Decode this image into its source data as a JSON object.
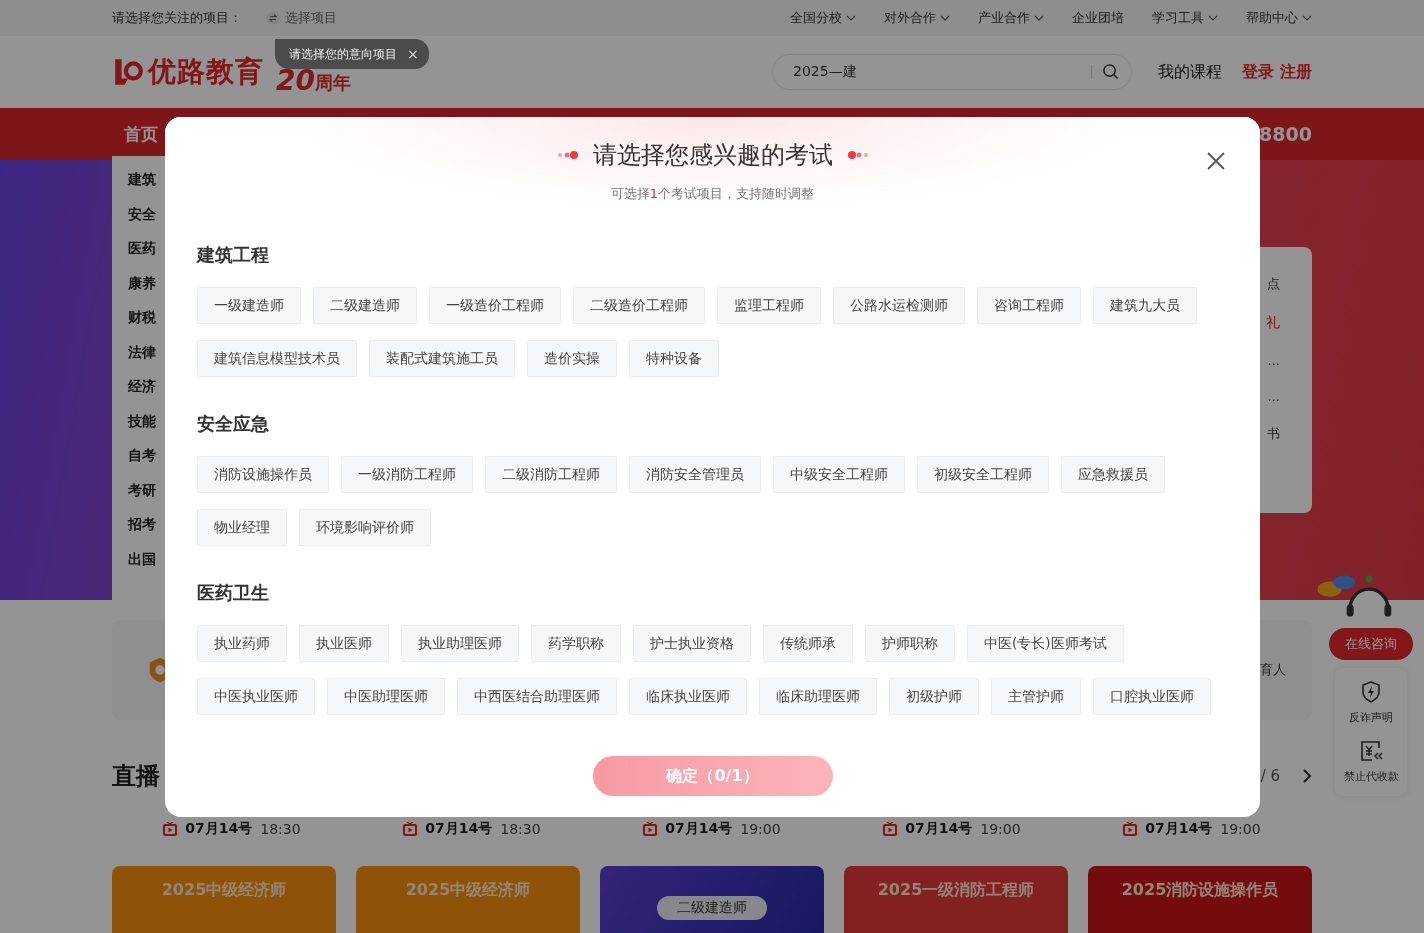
{
  "top_bar": {
    "prompt": "请选择您关注的项目：",
    "select_button": "选择项目",
    "menus": [
      {
        "label": "全国分校",
        "dropdown": true
      },
      {
        "label": "对外合作",
        "dropdown": true
      },
      {
        "label": "产业合作",
        "dropdown": true
      },
      {
        "label": "企业团培",
        "dropdown": false
      },
      {
        "label": "学习工具",
        "dropdown": true
      },
      {
        "label": "帮助中心",
        "dropdown": true
      }
    ]
  },
  "tooltip": {
    "text": "请选择您的意向项目",
    "close": "×"
  },
  "header": {
    "logo": "优路教育",
    "anniversary_number": "20",
    "anniversary_label": "周年",
    "search": {
      "value": "2025—建"
    },
    "my_courses": "我的课程",
    "login": "登录",
    "register": "注册"
  },
  "nav": {
    "items": [
      {
        "label": "首页",
        "selected": true
      }
    ],
    "hotline": "8800"
  },
  "sidebar": {
    "items": [
      "建筑",
      "安全",
      "医药",
      "康养",
      "财税",
      "法律",
      "经济",
      "技能",
      "自考",
      "考研",
      "招考",
      "出国"
    ]
  },
  "promo_panel": {
    "lines": [
      {
        "text": "点",
        "highlight": false
      },
      {
        "text": "礼",
        "highlight": true
      },
      {
        "text": "...",
        "highlight": false
      },
      {
        "text": "...",
        "highlight": false
      },
      {
        "text": "书",
        "highlight": false
      }
    ]
  },
  "feature_row": {
    "text": "育人"
  },
  "live": {
    "title": "直播",
    "page": "/ 6",
    "dates": [
      {
        "date": "07月14号",
        "time": "18:30"
      },
      {
        "date": "07月14号",
        "time": "18:30"
      },
      {
        "date": "07月14号",
        "time": "19:00"
      },
      {
        "date": "07月14号",
        "time": "19:00"
      },
      {
        "date": "07月14号",
        "time": "19:00"
      }
    ],
    "cards": [
      {
        "kind": "banner",
        "title": "2025中级经济师"
      },
      {
        "kind": "banner",
        "title": "2025中级经济师"
      },
      {
        "kind": "pill",
        "title": "二级建造师"
      },
      {
        "kind": "banner",
        "title": "2025一级消防工程师"
      },
      {
        "kind": "banner",
        "title": "2025消防设施操作员"
      }
    ]
  },
  "float": {
    "consult": "在线咨询",
    "links": [
      {
        "label": "反诈声明",
        "kind": "shield"
      },
      {
        "label": "禁止代收款",
        "kind": "yen"
      }
    ]
  },
  "modal": {
    "title": "请选择您感兴趣的考试",
    "subtitle_before": "可选择",
    "subtitle_count": "1",
    "subtitle_after": "个考试项目，支持随时调整",
    "confirm": "确定（0/1）",
    "sections": [
      {
        "title": "建筑工程",
        "options": [
          {
            "label": "一级建造师",
            "selected": false
          },
          {
            "label": "二级建造师",
            "selected": false
          },
          {
            "label": "一级造价工程师",
            "selected": false
          },
          {
            "label": "二级造价工程师",
            "selected": false
          },
          {
            "label": "监理工程师",
            "selected": false
          },
          {
            "label": "公路水运检测师",
            "selected": false
          },
          {
            "label": "咨询工程师",
            "selected": false
          },
          {
            "label": "建筑九大员",
            "selected": false
          },
          {
            "label": "建筑信息模型技术员",
            "selected": false
          },
          {
            "label": "装配式建筑施工员",
            "selected": false
          },
          {
            "label": "造价实操",
            "selected": false
          },
          {
            "label": "特种设备",
            "selected": false
          }
        ]
      },
      {
        "title": "安全应急",
        "options": [
          {
            "label": "消防设施操作员",
            "selected": false
          },
          {
            "label": "一级消防工程师",
            "selected": false
          },
          {
            "label": "二级消防工程师",
            "selected": false
          },
          {
            "label": "消防安全管理员",
            "selected": false
          },
          {
            "label": "中级安全工程师",
            "selected": false
          },
          {
            "label": "初级安全工程师",
            "selected": false
          },
          {
            "label": "应急救援员",
            "selected": false
          },
          {
            "label": "物业经理",
            "selected": false
          },
          {
            "label": "环境影响评价师",
            "selected": false
          }
        ]
      },
      {
        "title": "医药卫生",
        "options": [
          {
            "label": "执业药师",
            "selected": false
          },
          {
            "label": "执业医师",
            "selected": false
          },
          {
            "label": "执业助理医师",
            "selected": false
          },
          {
            "label": "药学职称",
            "selected": false
          },
          {
            "label": "护士执业资格",
            "selected": false
          },
          {
            "label": "传统师承",
            "selected": false
          },
          {
            "label": "护师职称",
            "selected": false
          },
          {
            "label": "中医(专长)医师考试",
            "selected": false
          },
          {
            "label": "中医执业医师",
            "selected": false
          },
          {
            "label": "中医助理医师",
            "selected": false
          },
          {
            "label": "中西医结合助理医师",
            "selected": false
          },
          {
            "label": "临床执业医师",
            "selected": false
          },
          {
            "label": "临床助理医师",
            "selected": false
          },
          {
            "label": "初级护师",
            "selected": false
          },
          {
            "label": "主管护师",
            "selected": false
          },
          {
            "label": "口腔执业医师",
            "selected": false
          }
        ]
      }
    ]
  }
}
